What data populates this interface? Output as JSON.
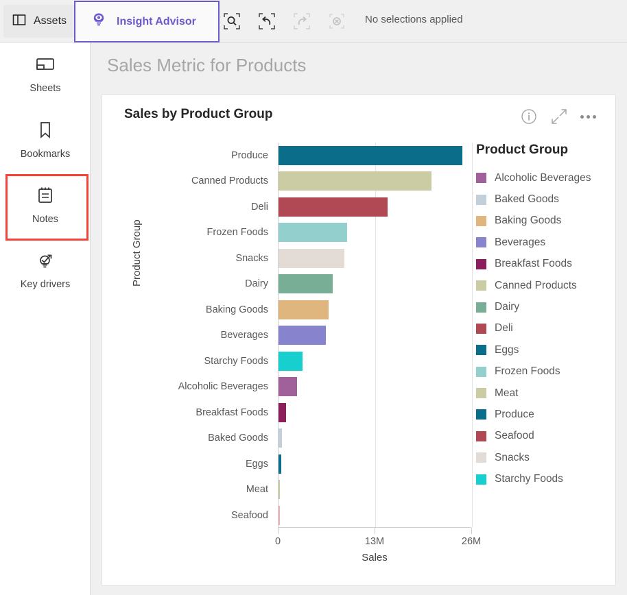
{
  "topbar": {
    "assets_label": "Assets",
    "assets_icon": "panel-layout-icon",
    "insight_advisor_label": "Insight Advisor",
    "insight_advisor_icon": "lightbulb-eye-icon",
    "tools": [
      {
        "name": "selection-search-icon",
        "label": "Search selections",
        "enabled": true
      },
      {
        "name": "step-back-icon",
        "label": "Step back",
        "enabled": true
      },
      {
        "name": "step-forward-icon",
        "label": "Step forward",
        "enabled": false
      },
      {
        "name": "clear-selections-icon",
        "label": "Clear all selections",
        "enabled": false
      }
    ],
    "no_selections_text": "No selections applied",
    "accent_tab_color": "#6A5ACD",
    "progress_color": "#00713E"
  },
  "sidebar": {
    "items": [
      {
        "label": "Sheets",
        "icon": "sheets-icon",
        "active": false
      },
      {
        "label": "Bookmarks",
        "icon": "bookmark-icon",
        "active": false
      },
      {
        "label": "Notes",
        "icon": "notes-icon",
        "active": true
      },
      {
        "label": "Key drivers",
        "icon": "key-drivers-icon",
        "active": false
      }
    ],
    "highlight_color": "#F44336"
  },
  "main": {
    "page_title": "Sales Metric for Products",
    "card": {
      "title": "Sales by Product Group",
      "actions": [
        {
          "name": "info-icon",
          "label": "Info"
        },
        {
          "name": "expand-icon",
          "label": "Fullscreen"
        },
        {
          "name": "more-options-icon",
          "label": "More options"
        }
      ]
    }
  },
  "chart_data": {
    "type": "bar",
    "orientation": "horizontal",
    "title": "Sales by Product Group",
    "xlabel": "Sales",
    "ylabel": "Product Group",
    "xlim": [
      0,
      26000000
    ],
    "xticks": [
      0,
      13000000,
      26000000
    ],
    "xtick_labels": [
      "0",
      "13M",
      "26M"
    ],
    "grid": true,
    "legend_position": "right",
    "legend_title": "Product Group",
    "categories": [
      "Produce",
      "Canned Products",
      "Deli",
      "Frozen Foods",
      "Snacks",
      "Dairy",
      "Baking Goods",
      "Beverages",
      "Starchy Foods",
      "Alcoholic Beverages",
      "Breakfast Foods",
      "Baked Goods",
      "Eggs",
      "Meat",
      "Seafood"
    ],
    "values": [
      24700000,
      20600000,
      14650000,
      9200000,
      8850000,
      7250000,
      6700000,
      6400000,
      3250000,
      2500000,
      1000000,
      480000,
      400000,
      140000,
      140000
    ],
    "colors": [
      "#0A6E8A",
      "#CBCCA4",
      "#B14955",
      "#93CFCC",
      "#E2DBD6",
      "#79AE96",
      "#E0B67F",
      "#8784CD",
      "#17CFCF",
      "#A0619A",
      "#8C1E5C",
      "#C3CFD9",
      "#0A6E8A",
      "#CBCCA4",
      "#E8B3B9"
    ],
    "legend_entries": [
      {
        "label": "Alcoholic Beverages",
        "color": "#A0619A"
      },
      {
        "label": "Baked Goods",
        "color": "#C3CFD9"
      },
      {
        "label": "Baking Goods",
        "color": "#E0B67F"
      },
      {
        "label": "Beverages",
        "color": "#8784CD"
      },
      {
        "label": "Breakfast Foods",
        "color": "#8C1E5C"
      },
      {
        "label": "Canned Products",
        "color": "#CBCCA4"
      },
      {
        "label": "Dairy",
        "color": "#79AE96"
      },
      {
        "label": "Deli",
        "color": "#B14955"
      },
      {
        "label": "Eggs",
        "color": "#0A6E8A"
      },
      {
        "label": "Frozen Foods",
        "color": "#93CFCC"
      },
      {
        "label": "Meat",
        "color": "#CBCCA4"
      },
      {
        "label": "Produce",
        "color": "#0A6E8A"
      },
      {
        "label": "Seafood",
        "color": "#B14955"
      },
      {
        "label": "Snacks",
        "color": "#E2DBD6"
      },
      {
        "label": "Starchy Foods",
        "color": "#17CFCF"
      }
    ]
  }
}
